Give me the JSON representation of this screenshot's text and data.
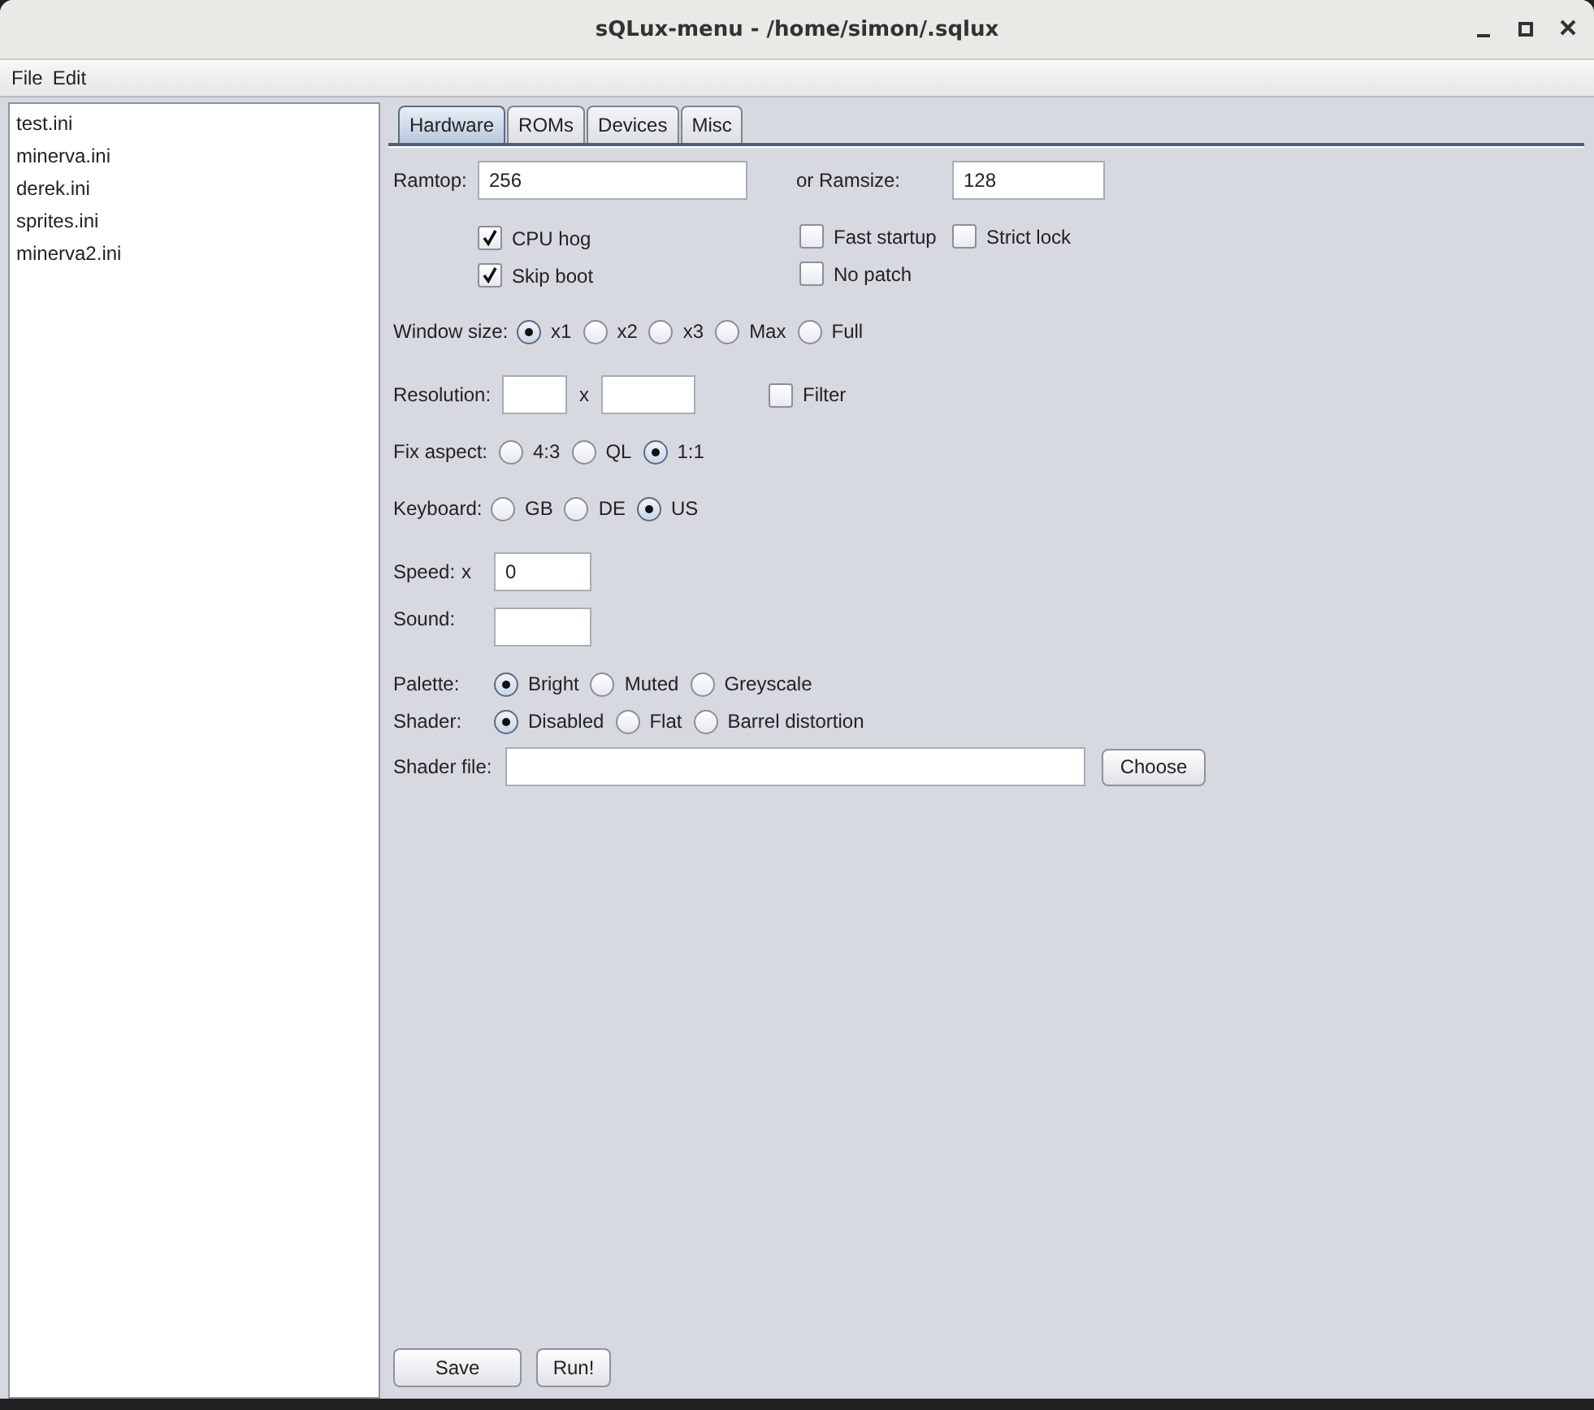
{
  "window": {
    "title": "sQLux-menu - /home/simon/.sqlux"
  },
  "menu": [
    "File",
    "Edit"
  ],
  "files": [
    "test.ini",
    "minerva.ini",
    "derek.ini",
    "sprites.ini",
    "minerva2.ini"
  ],
  "tabs": [
    {
      "label": "Hardware",
      "selected": true
    },
    {
      "label": "ROMs",
      "selected": false
    },
    {
      "label": "Devices",
      "selected": false
    },
    {
      "label": "Misc",
      "selected": false
    }
  ],
  "hardware": {
    "ramtop": {
      "label": "Ramtop:",
      "value": "256"
    },
    "ramsize": {
      "label": "or Ramsize:",
      "value": "128"
    },
    "option_rows": [
      [
        {
          "label": "CPU hog",
          "checked": true
        },
        {
          "label": "Fast startup",
          "checked": false
        },
        {
          "label": "Strict lock",
          "checked": false
        }
      ],
      [
        {
          "label": "Skip boot",
          "checked": true
        },
        {
          "label": "No patch",
          "checked": false
        }
      ]
    ],
    "window_size": {
      "label": "Window size:",
      "options": [
        {
          "label": "x1",
          "selected": true
        },
        {
          "label": "x2",
          "selected": false
        },
        {
          "label": "x3",
          "selected": false
        },
        {
          "label": "Max",
          "selected": false
        },
        {
          "label": "Full",
          "selected": false
        }
      ]
    },
    "resolution": {
      "label": "Resolution:",
      "separator": "x",
      "filter": {
        "label": "Filter",
        "checked": false
      }
    },
    "fix_aspect": {
      "label": "Fix aspect:",
      "options": [
        {
          "label": "4:3",
          "selected": false
        },
        {
          "label": "QL",
          "selected": false
        },
        {
          "label": "1:1",
          "selected": true
        }
      ]
    },
    "keyboard": {
      "label": "Keyboard:",
      "options": [
        {
          "label": "GB",
          "selected": false
        },
        {
          "label": "DE",
          "selected": false
        },
        {
          "label": "US",
          "selected": true
        }
      ]
    },
    "speed": {
      "label": "Speed:",
      "unit": "x",
      "value": "0"
    },
    "sound": {
      "label": "Sound:"
    },
    "palette": {
      "label": "Palette:",
      "options": [
        {
          "label": "Bright",
          "selected": true
        },
        {
          "label": "Muted",
          "selected": false
        },
        {
          "label": "Greyscale",
          "selected": false
        }
      ]
    },
    "shader": {
      "label": "Shader:",
      "options": [
        {
          "label": "Disabled",
          "selected": true
        },
        {
          "label": "Flat",
          "selected": false
        },
        {
          "label": "Barrel distortion",
          "selected": false
        }
      ]
    },
    "shader_file": {
      "label": "Shader file:",
      "button": "Choose"
    }
  },
  "buttons": [
    "Save",
    "Run!"
  ]
}
